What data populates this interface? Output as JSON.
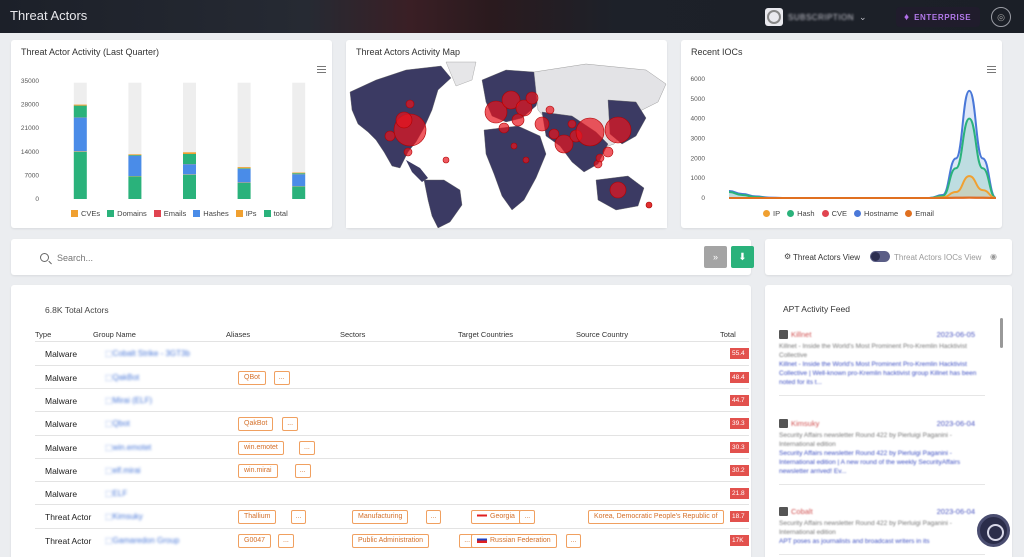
{
  "header": {
    "title": "Threat Actors",
    "org_name": "SUBSCRIPTION",
    "edition": "ENTERPRISE"
  },
  "activity_chart": {
    "title": "Threat Actor Activity (Last Quarter)",
    "menu_icon": "menu-icon",
    "legend": [
      {
        "name": "CVEs",
        "color": "#f0a030"
      },
      {
        "name": "Domains",
        "color": "#2ab27b"
      },
      {
        "name": "Emails",
        "color": "#e04450"
      },
      {
        "name": "Hashes",
        "color": "#4a8ce8"
      },
      {
        "name": "IPs",
        "color": "#f0a030"
      },
      {
        "name": "total",
        "color": "#2ab27b"
      }
    ]
  },
  "map_card": {
    "title": "Threat Actors Activity Map"
  },
  "iocs_chart": {
    "title": "Recent IOCs",
    "legend": [
      {
        "name": "IP",
        "color": "#f0a030"
      },
      {
        "name": "Hash",
        "color": "#2ab27b"
      },
      {
        "name": "CVE",
        "color": "#e04450"
      },
      {
        "name": "Hostname",
        "color": "#4a78d8"
      },
      {
        "name": "Email",
        "color": "#e07020"
      }
    ]
  },
  "chart_data": [
    {
      "type": "bar",
      "title": "Threat Actor Activity (Last Quarter)",
      "categories": [
        "1",
        "2",
        "3",
        "4",
        "5"
      ],
      "ylim": [
        0,
        35000
      ],
      "yticks": [
        0,
        7000,
        14000,
        21000,
        28000,
        35000
      ],
      "series": [
        {
          "name": "CVEs",
          "values": [
            300,
            200,
            500,
            300,
            200
          ]
        },
        {
          "name": "Domains",
          "values": [
            3500,
            200,
            3000,
            200,
            300
          ]
        },
        {
          "name": "Emails",
          "values": [
            50,
            50,
            50,
            50,
            50
          ]
        },
        {
          "name": "Hashes",
          "values": [
            10000,
            6000,
            3000,
            4000,
            3500
          ]
        },
        {
          "name": "IPs",
          "values": [
            150,
            100,
            100,
            100,
            100
          ]
        },
        {
          "name": "total",
          "values": [
            14000,
            6700,
            7200,
            4800,
            3700
          ]
        }
      ],
      "background_total": [
        34500,
        34500,
        34500,
        34500,
        34500
      ]
    },
    {
      "type": "area",
      "title": "Recent IOCs",
      "ylim": [
        0,
        6000
      ],
      "yticks": [
        0,
        1000,
        2000,
        3000,
        4000,
        5000,
        6000
      ],
      "x": [
        0,
        1,
        2,
        3,
        4,
        5,
        6,
        7,
        8,
        9,
        10,
        11,
        12,
        13,
        14,
        15,
        16,
        17,
        18,
        19,
        20
      ],
      "series": [
        {
          "name": "IP",
          "values": [
            0,
            0,
            0,
            0,
            0,
            0,
            0,
            0,
            0,
            0,
            0,
            0,
            0,
            0,
            0,
            0,
            30,
            300,
            1100,
            400,
            0
          ]
        },
        {
          "name": "Hash",
          "values": [
            300,
            150,
            50,
            0,
            0,
            0,
            0,
            0,
            0,
            0,
            0,
            0,
            0,
            0,
            0,
            0,
            100,
            1500,
            4000,
            1500,
            0
          ]
        },
        {
          "name": "CVE",
          "values": [
            0,
            0,
            0,
            0,
            0,
            0,
            0,
            0,
            0,
            0,
            0,
            0,
            0,
            0,
            0,
            0,
            0,
            10,
            20,
            10,
            0
          ]
        },
        {
          "name": "Hostname",
          "values": [
            350,
            200,
            80,
            20,
            0,
            0,
            0,
            0,
            0,
            0,
            0,
            0,
            0,
            0,
            0,
            0,
            150,
            2000,
            5400,
            2000,
            0
          ]
        },
        {
          "name": "Email",
          "values": [
            0,
            0,
            0,
            0,
            0,
            0,
            0,
            0,
            0,
            0,
            0,
            0,
            0,
            0,
            0,
            0,
            0,
            10,
            20,
            10,
            0
          ]
        }
      ]
    }
  ],
  "search": {
    "placeholder": "Search..."
  },
  "view_toggle": {
    "label_left": "Threat Actors View",
    "label_right": "Threat Actors IOCs View"
  },
  "table": {
    "count_label": "6.8K Total Actors",
    "columns": [
      "Type",
      "Group Name",
      "Aliases",
      "Sectors",
      "Target Countries",
      "Source Country",
      "Total"
    ],
    "rows": [
      {
        "type": "Malware",
        "name": "Cobalt Strike - 3GT3b",
        "aliases": [],
        "sectors": [],
        "countries": [],
        "source": "",
        "total": "55.4"
      },
      {
        "type": "Malware",
        "name": "QakBot",
        "aliases": [
          "QBot",
          "..."
        ],
        "sectors": [],
        "countries": [],
        "source": "",
        "total": "48.4"
      },
      {
        "type": "Malware",
        "name": "Mirai (ELF)",
        "aliases": [],
        "sectors": [],
        "countries": [],
        "source": "",
        "total": "44.7"
      },
      {
        "type": "Malware",
        "name": "Qbot",
        "aliases": [
          "QakBot",
          "..."
        ],
        "sectors": [],
        "countries": [],
        "source": "",
        "total": "39.3"
      },
      {
        "type": "Malware",
        "name": "win.emotet",
        "aliases": [
          "win.emotet",
          "..."
        ],
        "sectors": [],
        "countries": [],
        "source": "",
        "total": "30.3"
      },
      {
        "type": "Malware",
        "name": "elf.mirai",
        "aliases": [
          "win.mirai",
          "..."
        ],
        "sectors": [],
        "countries": [],
        "source": "",
        "total": "30.2"
      },
      {
        "type": "Malware",
        "name": "ELF",
        "aliases": [],
        "sectors": [],
        "countries": [],
        "source": "",
        "total": "21.8"
      },
      {
        "type": "Threat Actor",
        "name": "Kimsuky",
        "aliases": [
          "Thallium",
          "..."
        ],
        "sectors": [
          "Manufacturing",
          "..."
        ],
        "countries": [
          "Georgia",
          "..."
        ],
        "source": "Korea, Democratic People's Republic of",
        "total": "18.7"
      },
      {
        "type": "Threat Actor",
        "name": "Gamaredon Group",
        "aliases": [
          "G0047",
          "..."
        ],
        "sectors": [
          "Public Administration",
          "..."
        ],
        "countries": [
          "Russian Federation",
          "..."
        ],
        "source": "",
        "total": "17K"
      }
    ]
  },
  "feed": {
    "title": "APT Activity Feed",
    "items": [
      {
        "name": "Killnet",
        "date": "2023-06-05",
        "desc": "Killnet - Inside the World's Most Prominent Pro-Kremlin Hacktivist Collective",
        "link": "Killnet - Inside the World's Most Prominent Pro-Kremlin Hacktivist Collective | Well-known pro-Kremlin hacktivist group Killnet has been noted for its t..."
      },
      {
        "name": "Kimsuky",
        "date": "2023-06-04",
        "desc": "Security Affairs newsletter Round 422 by Pierluigi Paganini - International edition",
        "link": "Security Affairs newsletter Round 422 by Pierluigi Paganini - International edition | A new round of the weekly SecurityAffairs newsletter arrived! Ev..."
      },
      {
        "name": "Cobalt",
        "date": "2023-06-04",
        "desc": "Security Affairs newsletter Round 422 by Pierluigi Paganini - International edition",
        "link": "APT poses as journalists and broadcast writers in its"
      }
    ]
  }
}
